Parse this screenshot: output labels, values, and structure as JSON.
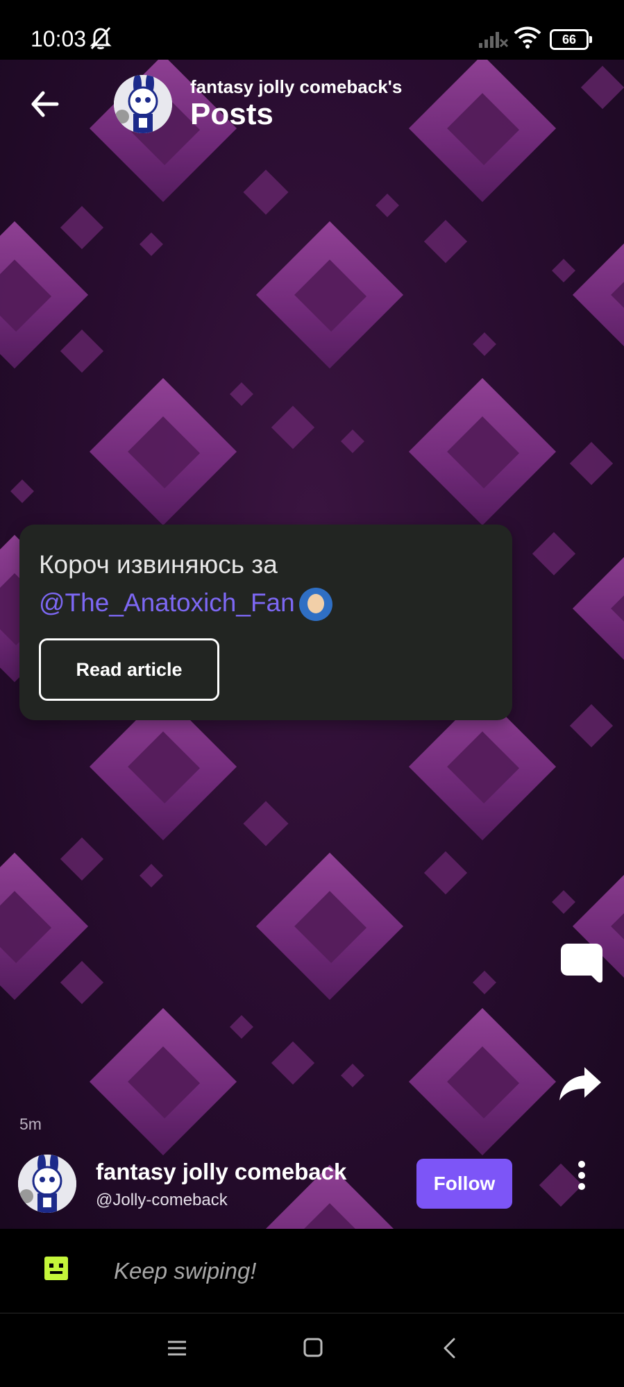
{
  "status_bar": {
    "time": "10:03",
    "battery": "66",
    "icons": [
      "bell-off-icon",
      "signal-icon",
      "wifi-icon",
      "battery-icon"
    ]
  },
  "header": {
    "subtitle": "fantasy jolly comeback's",
    "title": "Posts"
  },
  "post": {
    "text": "Короч извиняюсь за",
    "mention": "@The_Anatoxich_Fan",
    "read_button": "Read article",
    "timestamp": "5m"
  },
  "author": {
    "name": "fantasy jolly comeback",
    "handle": "@Jolly-comeback",
    "follow_label": "Follow"
  },
  "banner": {
    "text": "Keep swiping!"
  },
  "colors": {
    "accent": "#7d55f7",
    "mention": "#7d68f4",
    "card": "#222522",
    "background": "#2a0d31"
  }
}
